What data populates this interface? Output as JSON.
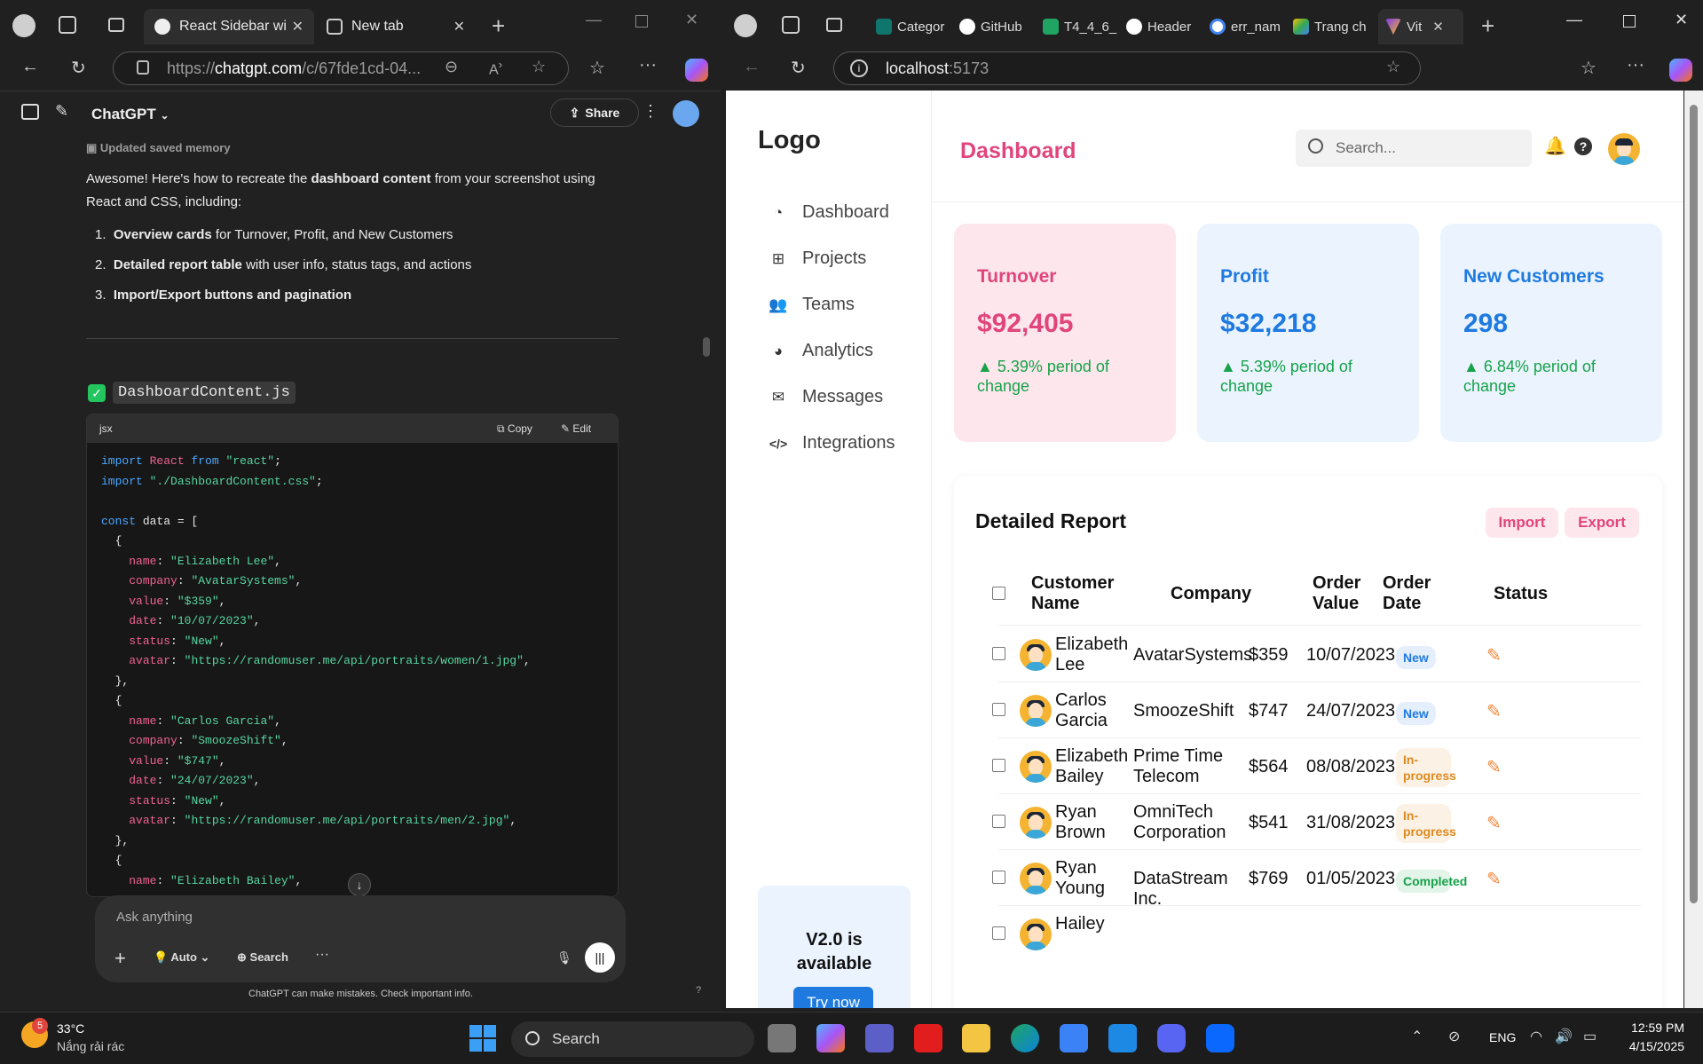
{
  "left_browser": {
    "tabs": [
      {
        "title": "React Sidebar wi"
      },
      {
        "title": "New tab"
      }
    ],
    "url_prefix": "https://",
    "url_host": "chatgpt.com",
    "url_rest": "/c/67fde1cd-04..."
  },
  "chatgpt": {
    "app_name": "ChatGPT",
    "share_label": "Share",
    "memory_note": "Updated saved memory",
    "intro_1": "Awesome! Here's how to recreate the ",
    "intro_bold": "dashboard content",
    "intro_2": " from your screenshot using",
    "intro_3": "React and CSS, including:",
    "list": [
      {
        "num": "1.",
        "bold": "Overview cards",
        "rest": " for Turnover, Profit, and New Customers"
      },
      {
        "num": "2.",
        "bold": "Detailed report table",
        "rest": " with user info, status tags, and actions"
      },
      {
        "num": "3.",
        "bold": "Import/Export buttons and pagination",
        "rest": ""
      }
    ],
    "file_name": "DashboardContent.js",
    "code_lang": "jsx",
    "copy_label": "Copy",
    "edit_label": "Edit",
    "compose_placeholder": "Ask anything",
    "auto_label": "Auto",
    "search_label": "Search",
    "disclaimer": "ChatGPT can make mistakes. Check important info.",
    "help_mark": "?"
  },
  "right_browser": {
    "tabs": [
      "Categor",
      "GitHub",
      "T4_4_6_",
      "Header",
      "err_nam",
      "Trang ch",
      "Vit"
    ],
    "url_host": "localhost",
    "url_port": ":5173"
  },
  "dashboard": {
    "logo": "Logo",
    "page_title": "Dashboard",
    "search_placeholder": "Search...",
    "nav": [
      {
        "label": "Dashboard",
        "icon": "gauge-icon"
      },
      {
        "label": "Projects",
        "icon": "project-diagram-icon"
      },
      {
        "label": "Teams",
        "icon": "users-icon"
      },
      {
        "label": "Analytics",
        "icon": "pie-chart-icon"
      },
      {
        "label": "Messages",
        "icon": "envelope-icon"
      },
      {
        "label": "Integrations",
        "icon": "code-icon"
      }
    ],
    "promo_title": "V2.0 is available",
    "promo_button": "Try now",
    "cards": [
      {
        "title": "Turnover",
        "value": "$92,405",
        "change": "▲ 5.39% period of change",
        "bg": "#fde6ec",
        "accent": "#e0457b"
      },
      {
        "title": "Profit",
        "value": "$32,218",
        "change": "▲ 5.39% period of change",
        "bg": "#ebf4fe",
        "accent": "#1f7ae0"
      },
      {
        "title": "New Customers",
        "value": "298",
        "change": "▲ 6.84% period of change",
        "bg": "#ebf4fe",
        "accent": "#1f7ae0"
      }
    ],
    "report_title": "Detailed Report",
    "import_label": "Import",
    "export_label": "Export",
    "columns": [
      "Customer Name",
      "Company",
      "Order Value",
      "Order Date",
      "Status"
    ],
    "rows": [
      {
        "name": "Elizabeth Lee",
        "company": "AvatarSystems",
        "value": "$359",
        "date": "10/07/2023",
        "status": "New"
      },
      {
        "name": "Carlos Garcia",
        "company": "SmoozeShift",
        "value": "$747",
        "date": "24/07/2023",
        "status": "New"
      },
      {
        "name": "Elizabeth Bailey",
        "company": "Prime Time Telecom",
        "value": "$564",
        "date": "08/08/2023",
        "status": "In-progress"
      },
      {
        "name": "Ryan Brown",
        "company": "OmniTech Corporation",
        "value": "$541",
        "date": "31/08/2023",
        "status": "In-progress"
      },
      {
        "name": "Ryan Young",
        "company": "DataStream Inc.",
        "value": "$769",
        "date": "01/05/2023",
        "status": "Completed"
      },
      {
        "name": "Hailey",
        "company": "",
        "value": "",
        "date": "",
        "status": ""
      }
    ],
    "status_colors": {
      "New": "#1f7ae0",
      "In-progress": "#e08a1f",
      "Completed": "#16a34a"
    }
  },
  "taskbar": {
    "weather_temp": "33°C",
    "weather_desc": "Nắng rải rác",
    "weather_badge": "5",
    "search_label": "Search",
    "lang": "ENG",
    "time": "12:59 PM",
    "date": "4/15/2025"
  }
}
